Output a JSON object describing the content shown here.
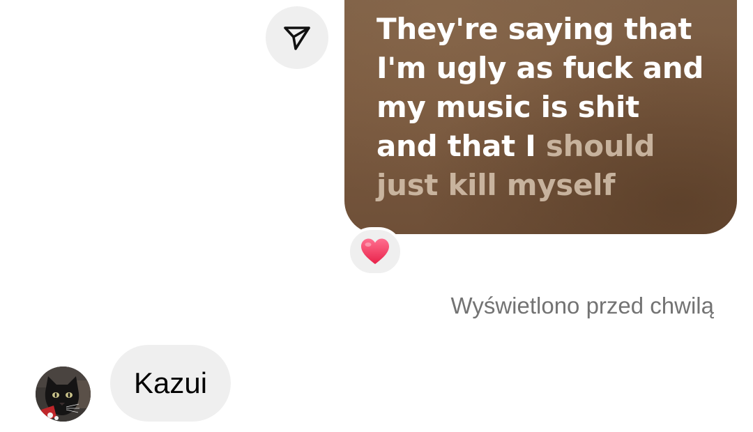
{
  "outgoing_media": {
    "lyrics_bright": "They're saying that I'm ugly as fuck and my music is shit and that I ",
    "lyrics_dim": "should just kill myself"
  },
  "reaction": {
    "emoji": "❤️",
    "icon": "heart-icon"
  },
  "share_button": {
    "icon": "send-arrow-icon"
  },
  "seen_status": "Wyświetlono przed chwilą",
  "incoming_message": {
    "text": "Kazui",
    "avatar_icon": "cat-avatar"
  },
  "colors": {
    "bubble_gray": "#efefef",
    "media_brown": "#7a5a40",
    "seen_gray": "#737373"
  }
}
